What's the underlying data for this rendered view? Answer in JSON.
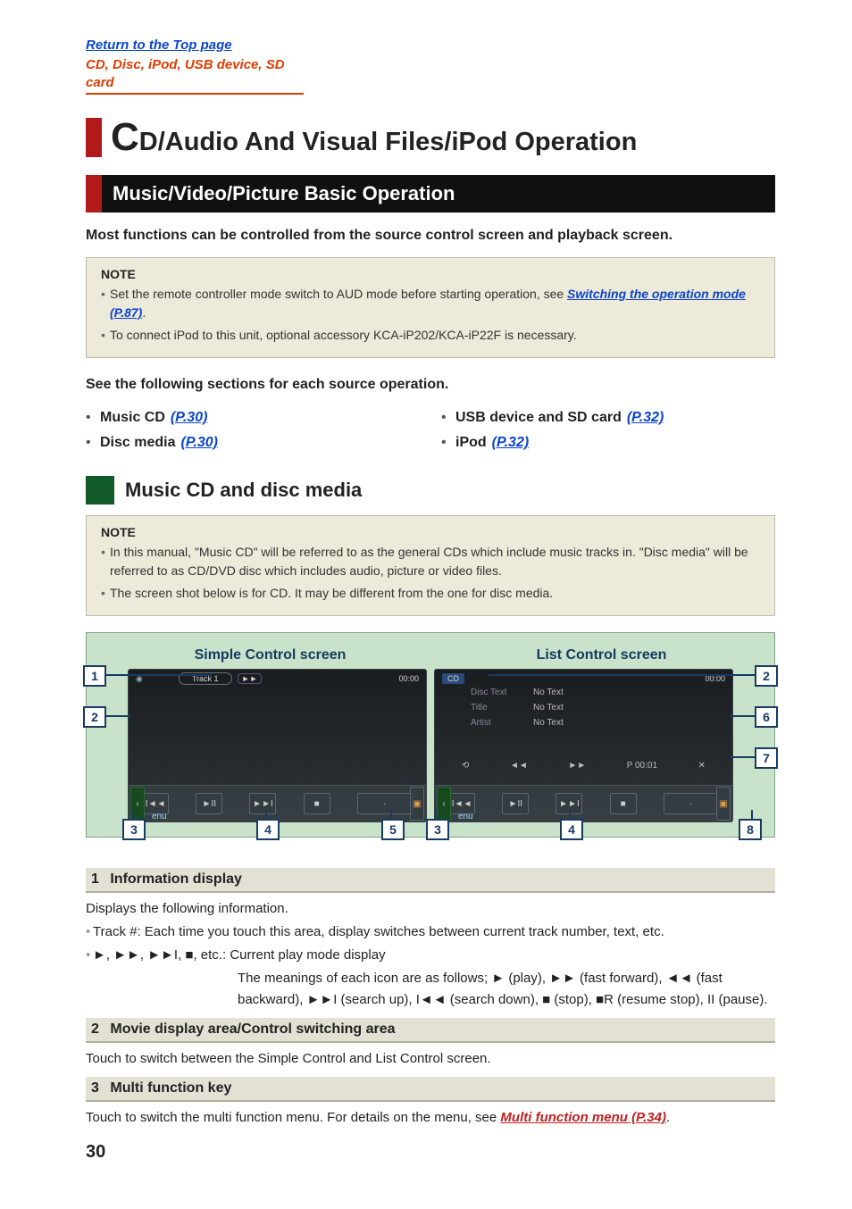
{
  "header": {
    "top_link": "Return to the Top page",
    "context": "CD, Disc, iPod, USB device, SD card"
  },
  "title": {
    "drop_cap": "C",
    "rest": "D/Audio And Visual Files/iPod Operation"
  },
  "section": "Music/Video/Picture Basic Operation",
  "intro_bold": "Most functions can be controlled from the source control screen and playback screen.",
  "note1": {
    "label": "NOTE",
    "items": [
      {
        "pre": "Set the remote controller mode switch to AUD mode before starting operation, see ",
        "link": "Switching the operation mode (P.87)",
        "post": "."
      },
      {
        "pre": "To connect iPod to this unit, optional accessory KCA-iP202/KCA-iP22F is necessary.",
        "link": "",
        "post": ""
      }
    ]
  },
  "source_intro": "See the following sections for each source operation.",
  "sources": [
    {
      "label": "Music CD",
      "ref": "(P.30)"
    },
    {
      "label": "USB device and SD card",
      "ref": "(P.32)"
    },
    {
      "label": "Disc media",
      "ref": "(P.30)"
    },
    {
      "label": "iPod",
      "ref": "(P.32)"
    }
  ],
  "subsection": "Music CD and disc media",
  "note2": {
    "label": "NOTE",
    "items": [
      "In this manual, \"Music CD\" will be referred to as the general CDs which include music tracks in. \"Disc media\" will be referred to as CD/DVD disc which includes audio, picture or video files.",
      "The screen shot below is for CD. It may be different from the one for disc media."
    ]
  },
  "shot": {
    "left_title": "Simple Control screen",
    "right_title": "List Control screen",
    "simple": {
      "track_pill": "Track 1",
      "time": "00:00",
      "menu": "enu"
    },
    "list": {
      "cd_badge": "CD",
      "time": "00:00",
      "rows": [
        {
          "label": "Disc Text",
          "value": "No Text"
        },
        {
          "label": "Title",
          "value": "No Text"
        },
        {
          "label": "Artist",
          "value": "No Text"
        }
      ],
      "seek": {
        "left": "◄◄",
        "right": "►►",
        "pos": "P 00:01"
      },
      "menu": "enu"
    }
  },
  "callouts": [
    "1",
    "2",
    "2",
    "3",
    "4",
    "5",
    "3",
    "4",
    "6",
    "7",
    "8"
  ],
  "desc": [
    {
      "num": "1",
      "title": "Information display",
      "body": {
        "lead": "Displays the following information.",
        "lines": [
          {
            "prefix": "Track #",
            "rest": ": Each time you touch this area, display switches between current track number, text, etc."
          },
          {
            "prefix": "►, ►►, ►►I, ■, etc.",
            "rest": ": Current play mode display"
          }
        ],
        "meanings": "The meanings of each icon are as follows; ► (play), ►► (fast forward), ◄◄ (fast backward), ►►I (search up), I◄◄ (search down), ■ (stop), ■R (resume stop), II (pause)."
      }
    },
    {
      "num": "2",
      "title": "Movie display area/Control switching area",
      "body": {
        "plain": "Touch to switch between the Simple Control and List Control screen."
      }
    },
    {
      "num": "3",
      "title": "Multi function key",
      "body": {
        "plain_pre": "Touch to switch the multi function menu. For details on the menu, see ",
        "link": "Multi function menu (P.34)",
        "plain_post": "."
      }
    }
  ],
  "page_number": "30"
}
